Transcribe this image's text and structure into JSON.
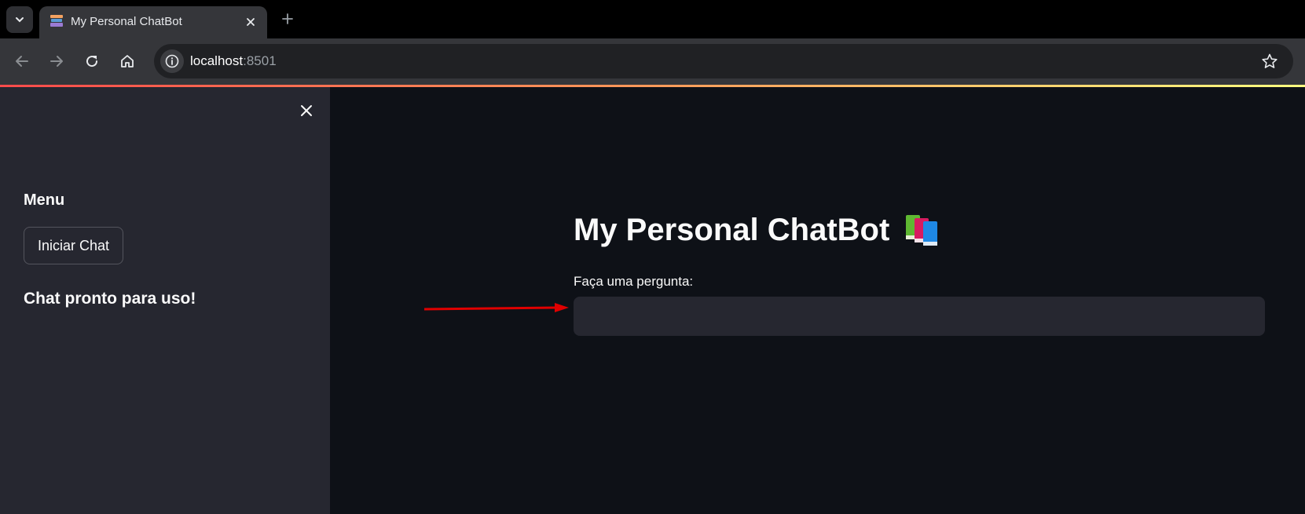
{
  "browser": {
    "tab_title": "My Personal ChatBot",
    "url_host": "localhost",
    "url_port": ":8501",
    "icons": {
      "tab_list": "chevron-down-icon",
      "tab_close": "close-icon",
      "new_tab": "plus-icon",
      "back": "arrow-left-icon",
      "forward": "arrow-right-icon",
      "reload": "reload-icon",
      "home": "home-icon",
      "site_info": "info-icon",
      "bookmark": "star-icon"
    }
  },
  "sidebar": {
    "heading": "Menu",
    "start_button_label": "Iniciar Chat",
    "status_text": "Chat pronto para uso!"
  },
  "main": {
    "title": "My Personal ChatBot",
    "title_icon": "books-icon",
    "input_label": "Faça uma pergunta:",
    "input_value": ""
  },
  "colors": {
    "app_background": "#0e1117",
    "sidebar_background": "#262730",
    "input_background": "#262730",
    "annotation_arrow": "#e00000"
  }
}
